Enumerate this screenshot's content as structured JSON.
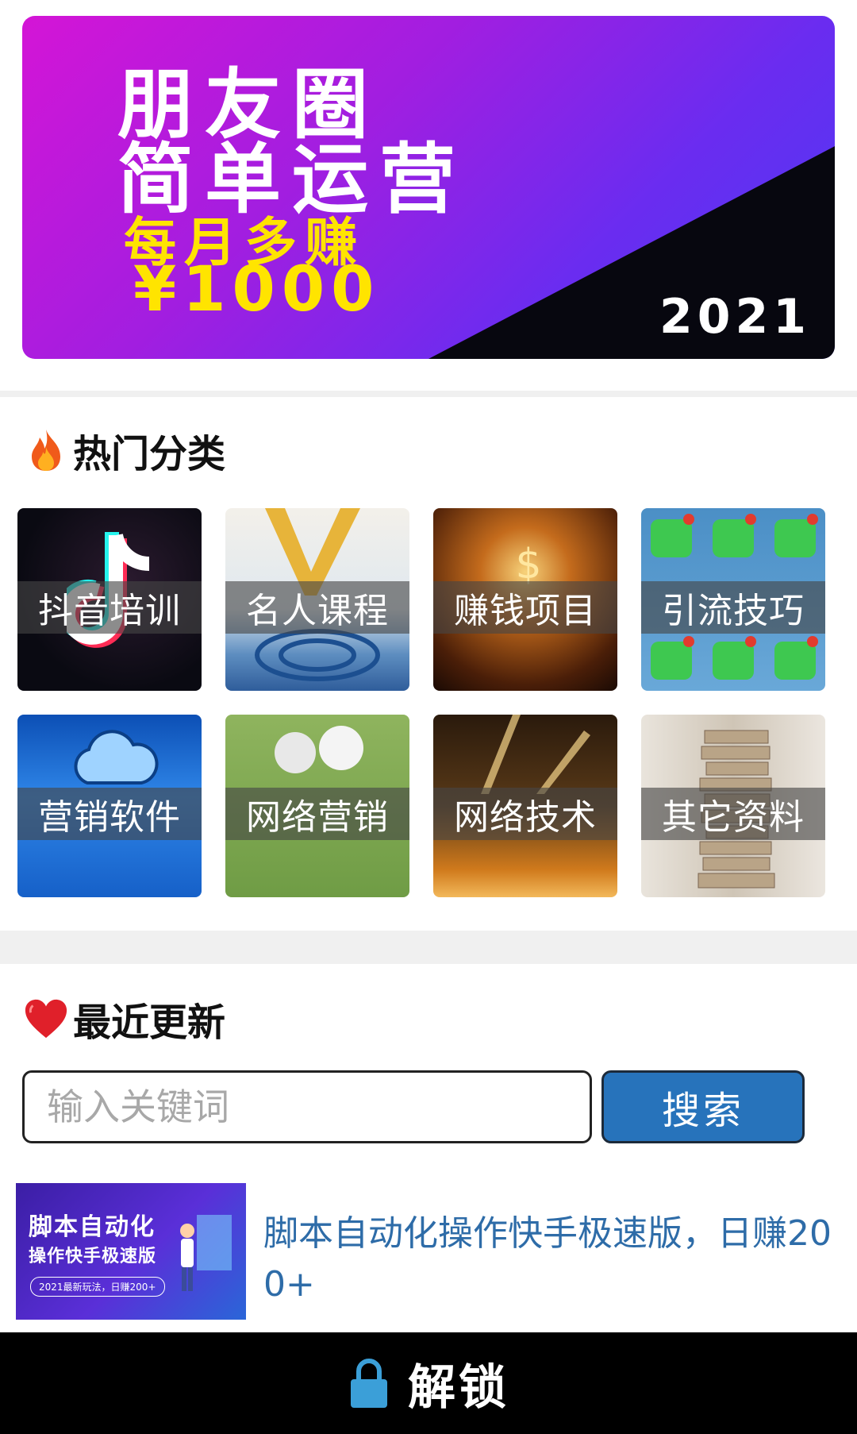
{
  "banner": {
    "line1": "朋友圈",
    "line2": "简单运营",
    "line3": "每月多赚",
    "line4": "¥1000",
    "year": "2021"
  },
  "hot": {
    "title": "热门分类",
    "icon": "fire-icon",
    "categories": [
      {
        "label": "抖音培训"
      },
      {
        "label": "名人课程"
      },
      {
        "label": "赚钱项目"
      },
      {
        "label": "引流技巧"
      },
      {
        "label": "营销软件"
      },
      {
        "label": "网络营销"
      },
      {
        "label": "网络技术"
      },
      {
        "label": "其它资料"
      }
    ]
  },
  "recent": {
    "title": "最近更新",
    "icon": "heart-icon",
    "search": {
      "placeholder": "输入关键词",
      "button_label": "搜索"
    },
    "articles": [
      {
        "thumb_line1": "脚本自动化",
        "thumb_line2": "操作快手极速版",
        "thumb_line3": "2021最新玩法，日赚200+",
        "title": "脚本自动化操作快手极速版，日赚200+"
      }
    ]
  },
  "unlock": {
    "icon": "lock-icon",
    "label": "解锁"
  },
  "colors": {
    "accent_blue": "#2773bb",
    "link_blue": "#2e6ca8",
    "banner_yellow": "#ffe400"
  }
}
